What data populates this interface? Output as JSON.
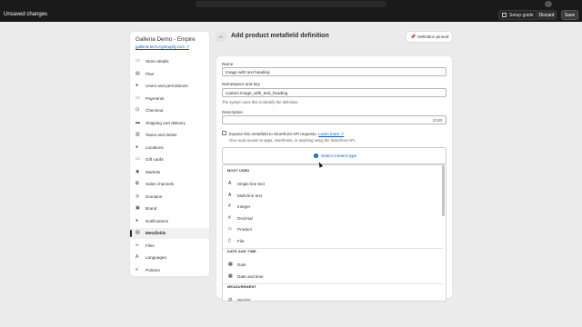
{
  "save_bar": {
    "title": "Unsaved changes",
    "setup_guide": "Setup guide",
    "discard": "Discard",
    "save": "Save"
  },
  "sidebar": {
    "store_name": "Galleria Demo - Empire",
    "store_url": "galleria-tech.myshopify.com",
    "items": [
      {
        "label": "Store details",
        "icon": "store-icon"
      },
      {
        "label": "Plan",
        "icon": "plan-icon"
      },
      {
        "label": "Users and permissions",
        "icon": "users-icon"
      },
      {
        "label": "Payments",
        "icon": "payments-icon"
      },
      {
        "label": "Checkout",
        "icon": "cart-icon"
      },
      {
        "label": "Shipping and delivery",
        "icon": "truck-icon"
      },
      {
        "label": "Taxes and duties",
        "icon": "taxes-icon"
      },
      {
        "label": "Locations",
        "icon": "location-icon"
      },
      {
        "label": "Gift cards",
        "icon": "gift-card-icon"
      },
      {
        "label": "Markets",
        "icon": "globe-icon"
      },
      {
        "label": "Sales channels",
        "icon": "channels-icon"
      },
      {
        "label": "Domains",
        "icon": "domains-icon"
      },
      {
        "label": "Brand",
        "icon": "brand-icon"
      },
      {
        "label": "Notifications",
        "icon": "bell-icon"
      },
      {
        "label": "Metafields",
        "icon": "metafields-icon",
        "active": true
      },
      {
        "label": "Files",
        "icon": "link-icon"
      },
      {
        "label": "Languages",
        "icon": "languages-icon"
      },
      {
        "label": "Policies",
        "icon": "policies-icon"
      }
    ]
  },
  "header": {
    "title": "Add product metafield definition",
    "pin_label": "Definition pinned"
  },
  "form": {
    "name_label": "Name",
    "name_value": "Image with text heading",
    "namespace_label": "Namespace and key",
    "namespace_value": "custom.image_with_text_heading",
    "namespace_help": "The system uses this to identify the definition.",
    "description_label": "Description",
    "description_value": "",
    "description_counter": "0/100",
    "expose_label": "Expose this metafield to Storefront API requests.",
    "learn_more": "Learn more",
    "expose_help": "Give read access to apps, storefronts, or anything using the Storefront API.",
    "select_type": "Select content type"
  },
  "dropdown": {
    "sections": [
      {
        "title": "MOST USED",
        "items": [
          {
            "label": "Single line text",
            "icon": "A"
          },
          {
            "label": "Multi-line text",
            "icon": "A"
          },
          {
            "label": "Integer",
            "icon": "#"
          },
          {
            "label": "Decimal",
            "icon": "#"
          },
          {
            "label": "Product",
            "icon": "◇"
          },
          {
            "label": "File",
            "icon": "▯"
          }
        ]
      },
      {
        "title": "DATE AND TIME",
        "items": [
          {
            "label": "Date",
            "icon": "▦"
          },
          {
            "label": "Date and time",
            "icon": "▦"
          }
        ]
      },
      {
        "title": "MEASUREMENT",
        "items": [
          {
            "label": "Weight",
            "icon": "⚖"
          }
        ]
      }
    ]
  }
}
